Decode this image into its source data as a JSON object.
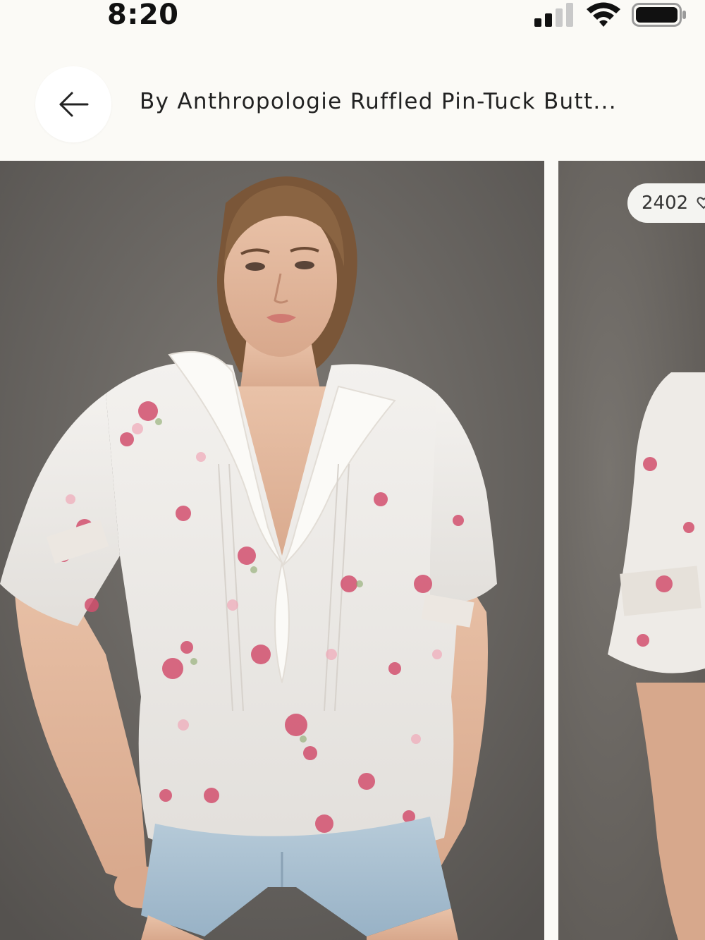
{
  "status_bar": {
    "time": "8:20"
  },
  "header": {
    "title": "By Anthropologie Ruffled Pin-Tuck Butt...",
    "back_icon": "arrow-left-icon"
  },
  "gallery": {
    "counter_text": "2402",
    "photos": [
      {
        "alt": "Model wearing white floral ruffled pin-tuck button-front blouse with denim shorts"
      },
      {
        "alt": "Partial view of the blouse, side angle"
      }
    ]
  },
  "colors": {
    "background": "#fbfaf6",
    "photo_backdrop": "#6e6a66",
    "blouse": "#f1efec",
    "floral_accent": "#d2506e",
    "denim": "#a9c1d3"
  }
}
